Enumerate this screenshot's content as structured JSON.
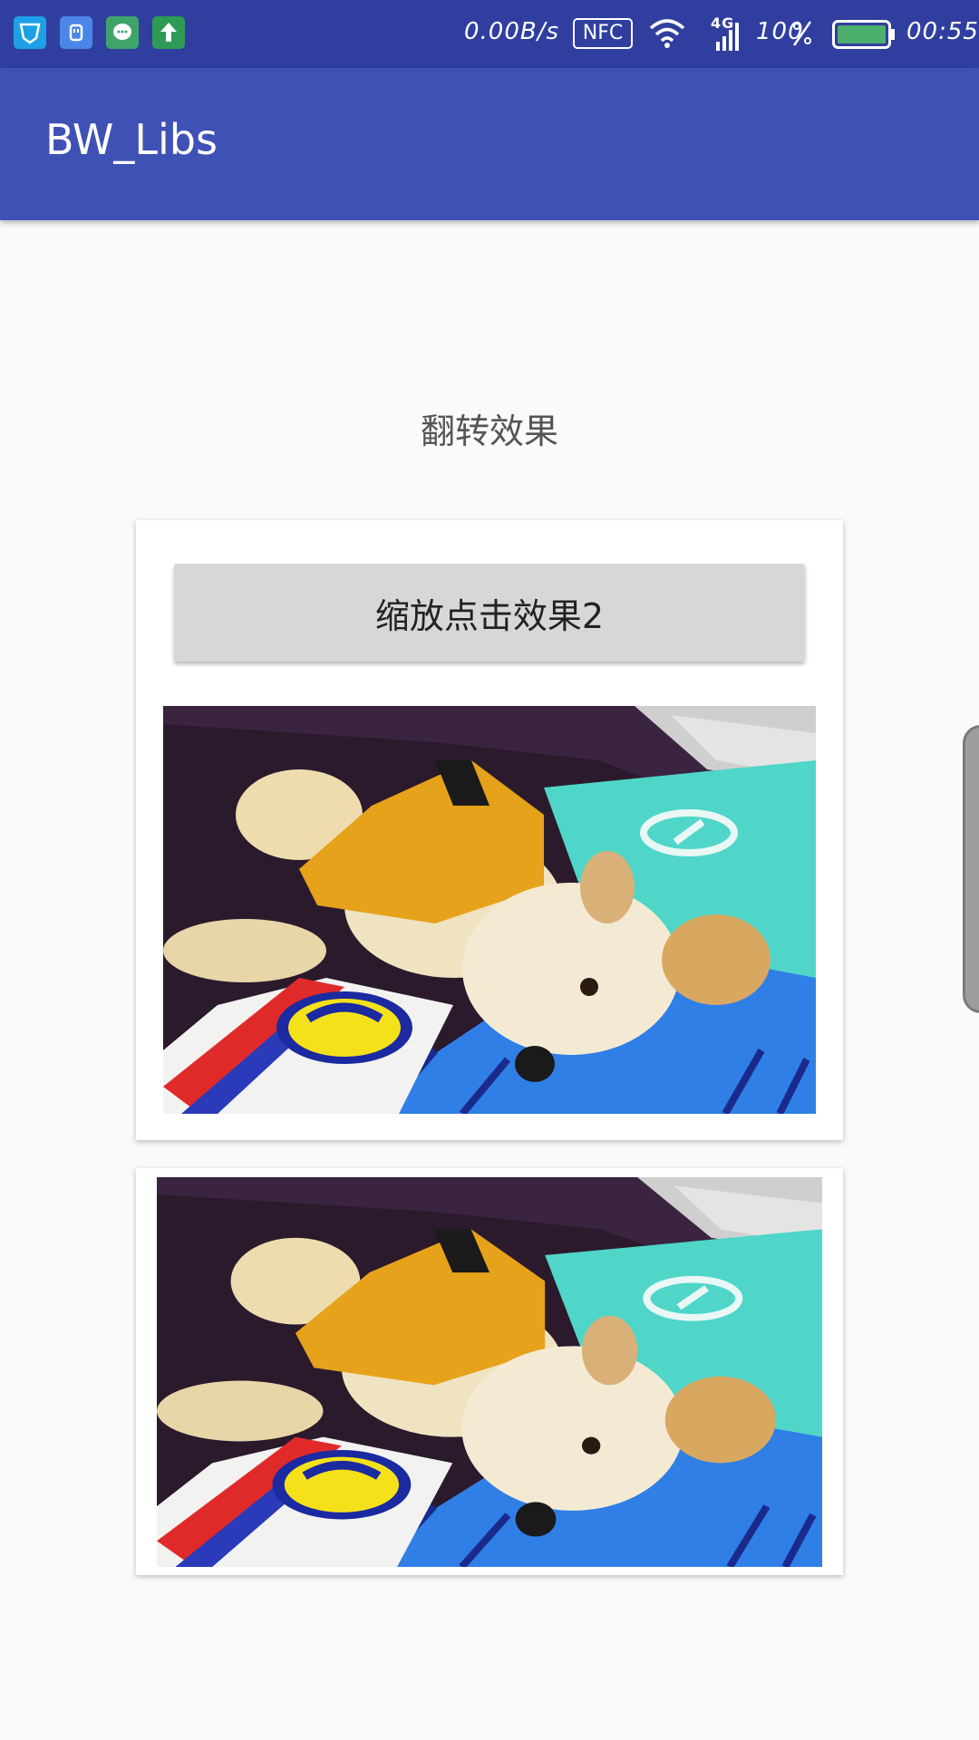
{
  "status_bar": {
    "notifications": [
      "shield-app-icon",
      "usb-icon",
      "message-bubble-icon",
      "upload-arrow-icon"
    ],
    "net_speed": "0.00B/s",
    "nfc": "NFC",
    "network_type": "4G",
    "battery_percent": "100",
    "time": "00:55",
    "icons": [
      "wifi-icon",
      "signal-icon",
      "battery-icon"
    ]
  },
  "app_bar": {
    "title": "BW_Libs"
  },
  "main": {
    "flip_label": "翻转效果",
    "scale_button_label": "缩放点击效果2",
    "images": [
      "dog-photo",
      "dog-photo"
    ]
  },
  "colors": {
    "status_bar": "#303f9f",
    "app_bar": "#3f51b5",
    "background": "#fafafa",
    "button": "#d6d7d7"
  }
}
